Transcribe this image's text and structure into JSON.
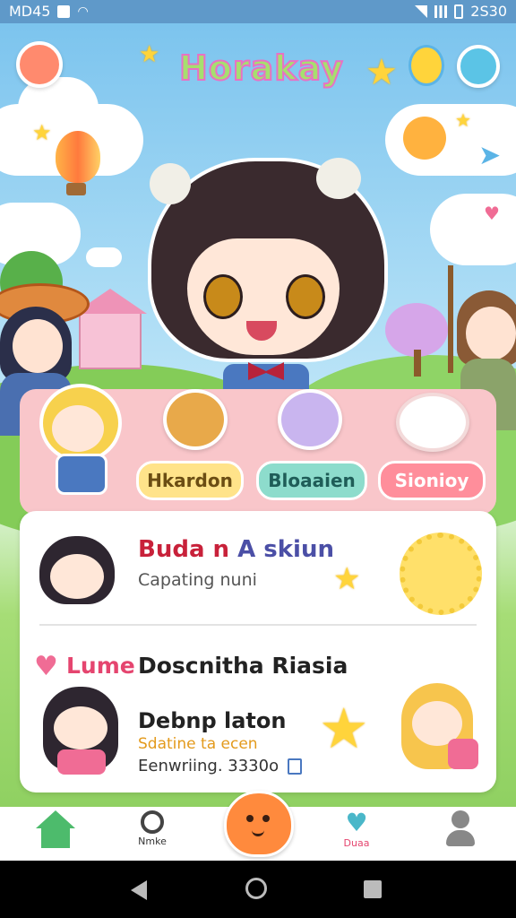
{
  "status_bar": {
    "time_left": "MD45",
    "time_right": "2S30"
  },
  "app": {
    "title": "Horakay"
  },
  "friends": {
    "pills": [
      {
        "label": "Hkardon",
        "color": "#ffe38a",
        "text_color": "#6b4d13"
      },
      {
        "label": "Bloaaien",
        "color": "#8ddccc",
        "text_color": "#1f5d58"
      },
      {
        "label": "Sionioy",
        "color": "#ff8e9b",
        "text_color": "#ffffff"
      }
    ]
  },
  "card": {
    "item1": {
      "title_part1": "Buda n",
      "title_part2": "A skiun",
      "subtitle": "Capating nuni"
    },
    "item2": {
      "tag": "Lume",
      "title": "Doscnitha Riasia"
    },
    "item3": {
      "title": "Debnp laton",
      "subtitle": "Sdatine ta ecen",
      "meta": "Eenwriing. 3330o"
    }
  },
  "bottom_nav": {
    "items": [
      {
        "label": "",
        "icon": "home-icon"
      },
      {
        "label": "Nmke",
        "icon": "search-icon"
      },
      {
        "label": "",
        "icon": "fab-blob-icon"
      },
      {
        "label": "Duaa",
        "icon": "heart-chat-icon"
      },
      {
        "label": "",
        "icon": "profile-icon"
      }
    ]
  },
  "colors": {
    "accent_pink": "#f9c6ca",
    "title_red": "#c8213a",
    "title_blue": "#4b4fa6",
    "fab_orange": "#ff8a3d"
  }
}
